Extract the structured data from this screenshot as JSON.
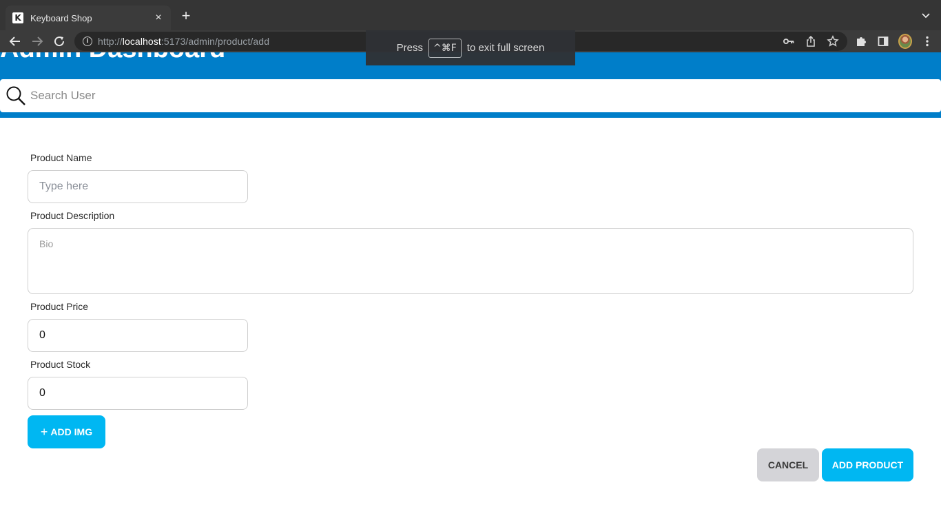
{
  "browser": {
    "tab_title": "Keyboard Shop",
    "favicon_letter": "K",
    "tab_close": "×",
    "new_tab": "+",
    "url_scheme": "http://",
    "url_host": "localhost",
    "url_path": ":5173/admin/product/add"
  },
  "fullscreen_notice": {
    "before": "Press",
    "key": "^⌘F",
    "after": "to exit full screen"
  },
  "header": {
    "title": "Admin Dashboard",
    "search_placeholder": "Search User"
  },
  "form": {
    "name_label": "Product Name",
    "name_placeholder": "Type here",
    "description_label": "Product Description",
    "description_placeholder": "Bio",
    "price_label": "Product Price",
    "price_value": "0",
    "stock_label": "Product Stock",
    "stock_value": "0",
    "add_img_icon": "+",
    "add_img_label": "ADD IMG",
    "cancel_label": "CANCEL",
    "submit_label": "ADD PRODUCT"
  },
  "colors": {
    "header_blue": "#007ec9",
    "accent_cyan": "#00b7f2",
    "cancel_gray": "#d4d4d8"
  }
}
